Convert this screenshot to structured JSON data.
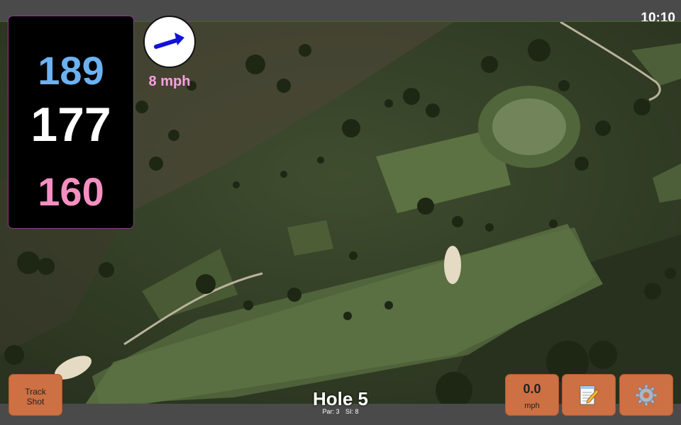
{
  "status_bar": {
    "time": "10:10"
  },
  "distances": {
    "back": "189",
    "middle": "177",
    "front": "160"
  },
  "wind": {
    "speed": "8 mph",
    "direction_icon": "arrow-east-northeast"
  },
  "hole": {
    "title": "Hole 5",
    "par_label": "Par: 3",
    "si_label": "SI: 8"
  },
  "buttons": {
    "track_shot_line1": "Track",
    "track_shot_line2": "Shot",
    "speed_value": "0.0",
    "speed_unit": "mph",
    "notes_icon": "notepad-pencil-icon",
    "settings_icon": "gear-icon"
  },
  "colors": {
    "back_distance": "#6cb2f2",
    "middle_distance": "#ffffff",
    "front_distance": "#f58fc2",
    "wind_text": "#ff9ee6",
    "button": "#cd7043"
  }
}
